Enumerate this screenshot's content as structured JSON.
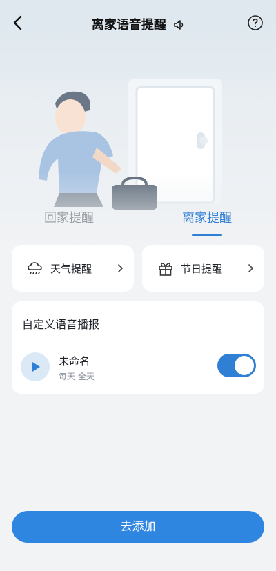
{
  "header": {
    "title": "离家语音提醒",
    "back_icon": "chevron-left-icon",
    "speaker_icon": "speaker-icon",
    "help_icon": "question-circle-icon"
  },
  "mode_tabs": {
    "items": [
      {
        "label": "回家提醒",
        "selected": false
      },
      {
        "label": "离家提醒",
        "selected": true
      }
    ]
  },
  "quick_cards": [
    {
      "label": "天气提醒",
      "icon": "cloud-rain-icon"
    },
    {
      "label": "节日提醒",
      "icon": "gift-icon"
    }
  ],
  "custom_section": {
    "title": "自定义语音播报",
    "items": [
      {
        "name": "未命名",
        "schedule": "每天 全天",
        "enabled": true
      }
    ]
  },
  "add_button": {
    "label": "去添加"
  },
  "colors": {
    "accent": "#2f86e0",
    "background": "#f2f3f5",
    "card": "#ffffff"
  }
}
